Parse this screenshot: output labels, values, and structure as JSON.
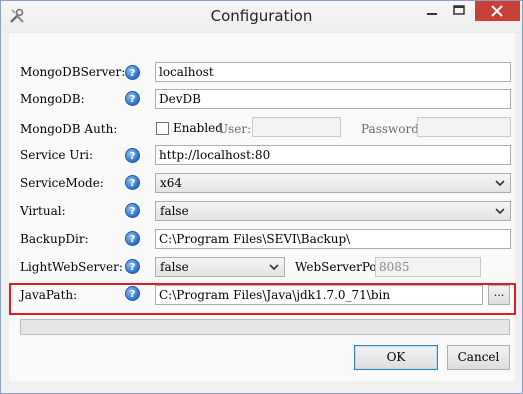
{
  "window": {
    "title": "Configuration"
  },
  "fields": {
    "mongo_server": {
      "label": "MongoDBServer:",
      "value": "localhost"
    },
    "mongo_db": {
      "label": "MongoDB:",
      "value": "DevDB"
    },
    "mongo_auth": {
      "label": "MongoDB Auth:",
      "checkbox_label": "Enabled",
      "checked": false,
      "user_label": "User:",
      "user_value": "",
      "password_label": "Password:",
      "password_value": ""
    },
    "service_uri": {
      "label": "Service Uri:",
      "value": "http://localhost:80"
    },
    "service_mode": {
      "label": "ServiceMode:",
      "value": "x64"
    },
    "virtual": {
      "label": "Virtual:",
      "value": "false"
    },
    "backup_dir": {
      "label": "BackupDir:",
      "value": "C:\\Program Files\\SEVI\\Backup\\"
    },
    "light_web_server": {
      "label": "LightWebServer:",
      "value": "false",
      "port_label": "WebServerPort:",
      "port_value": "8085"
    },
    "java_path": {
      "label": "JavaPath:",
      "value": "C:\\Program Files\\Java\\jdk1.7.0_71\\bin",
      "browse_label": "..."
    }
  },
  "progress": {
    "value": 0
  },
  "buttons": {
    "ok": "OK",
    "cancel": "Cancel"
  },
  "icons": {
    "app": "tools-icon",
    "help": "help-icon",
    "dropdown": "chevron-down-icon",
    "minimize": "minimize-icon",
    "maximize": "maximize-icon",
    "close": "close-icon"
  },
  "colors": {
    "highlight": "#e01d24",
    "close_button": "#c84037",
    "help_icon": "#2a70c8"
  }
}
